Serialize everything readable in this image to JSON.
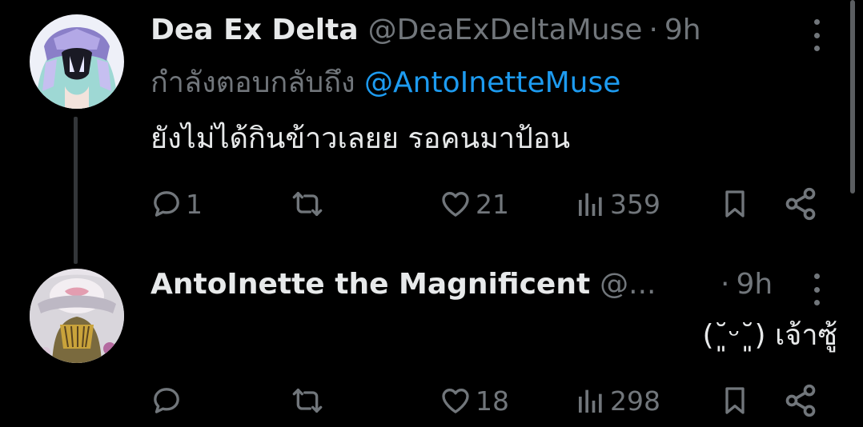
{
  "tweets": [
    {
      "display_name": "Dea Ex Delta",
      "handle": "@DeaExDeltaMuse",
      "separator": "·",
      "time": "9h",
      "reply_prefix": "กำลังตอบกลับถึง",
      "reply_mention": "@AntoInetteMuse",
      "text": "ยังไม่ได้กินข้าวเลยย รอคนมาป้อน",
      "reply_count": "1",
      "retweet_count": "",
      "like_count": "21",
      "view_count": "359"
    },
    {
      "display_name": "AntoInette the Magnificent",
      "handle": "@...",
      "separator": "·",
      "time": "9h",
      "text": "(˘͈ᵕ˘͈) เจ้าซู้",
      "reply_count": "",
      "retweet_count": "",
      "like_count": "18",
      "view_count": "298"
    }
  ],
  "icons": {
    "reply": "reply-bubble-icon",
    "retweet": "retweet-arrows-icon",
    "like": "heart-icon",
    "views": "bar-chart-icon",
    "bookmark": "bookmark-icon",
    "share": "share-icon",
    "more": "vertical-dots-icon"
  },
  "colors": {
    "background": "#000000",
    "primary_text": "#e7e9ea",
    "secondary_text": "#71767b",
    "mention": "#1d9bf0",
    "thread_line": "#333639"
  }
}
